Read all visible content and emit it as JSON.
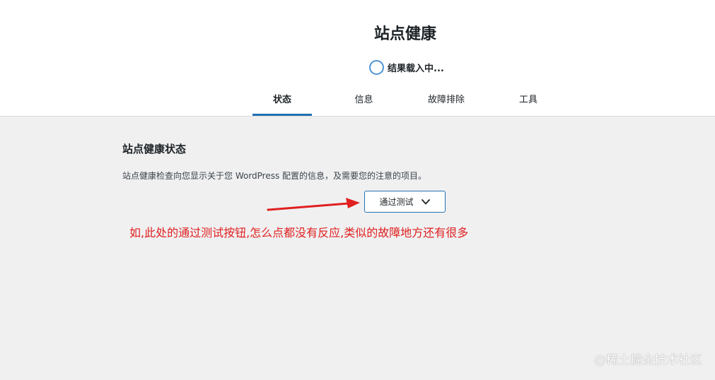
{
  "header": {
    "title": "站点健康",
    "progress_label": "结果载入中...",
    "tabs": [
      {
        "label": "状态",
        "active": true
      },
      {
        "label": "信息",
        "active": false
      },
      {
        "label": "故障排除",
        "active": false
      },
      {
        "label": "工具",
        "active": false
      }
    ]
  },
  "main": {
    "section_title": "站点健康状态",
    "section_description": "站点健康检查向您显示关于您 WordPress 配置的信息，及需要您的注意的项目。",
    "toggle_button_label": "通过测试"
  },
  "annotation": {
    "text": "如,此处的通过测试按钮,怎么点都没有反应,类似的故障地方还有很多",
    "color": "#e02020"
  },
  "watermark": "@稀土掘金技术社区",
  "colors": {
    "accent": "#2271b1",
    "progress_ring": "#4f94d4",
    "background": "#f0f0f1"
  }
}
